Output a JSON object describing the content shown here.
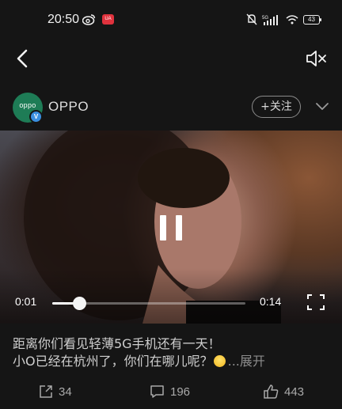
{
  "status_bar": {
    "time": "20:50",
    "app_badge": "UA",
    "battery": "43",
    "network": "5G",
    "icons": [
      "weibo-icon",
      "app-badge-icon",
      "mute-notification-icon",
      "signal-icon",
      "wifi-icon",
      "battery-icon"
    ]
  },
  "nav": {
    "back_icon": "back-arrow-icon",
    "mute_icon": "speaker-muted-icon"
  },
  "account": {
    "avatar_text": "oppo",
    "name": "OPPO",
    "verified_badge": "V",
    "follow_label": "+关注",
    "more_icon": "chevron-down-icon"
  },
  "video": {
    "state": "paused",
    "current_time": "0:01",
    "total_time": "0:14",
    "progress": 0.14,
    "fullscreen_icon": "fullscreen-icon"
  },
  "post": {
    "line1": "距离你们看见轻薄5G手机还有一天！",
    "line2": "小O已经在杭州了，你们在哪儿呢？",
    "emoji_icon": "smile-emoji-icon",
    "expand_label": "...展开"
  },
  "actions": {
    "repost_count": "34",
    "comment_count": "196",
    "like_count": "443"
  },
  "colors": {
    "background": "#151515",
    "avatar": "#1e7c56",
    "verified": "#3a8fe0",
    "badge": "#e0323d"
  }
}
